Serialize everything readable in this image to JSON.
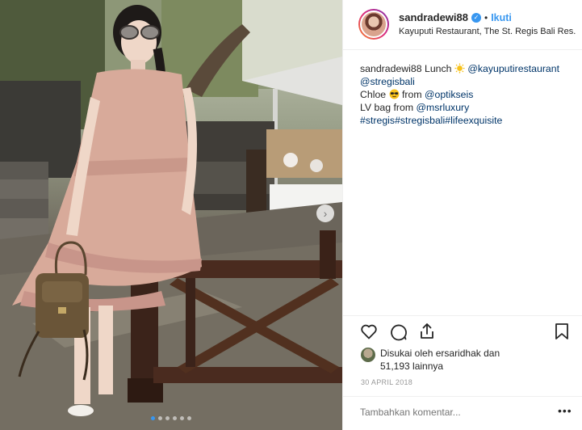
{
  "header": {
    "username": "sandradewi88",
    "separator": "•",
    "follow_label": "Ikuti",
    "location": "Kayuputi Restaurant, The St. Regis Bali Res..."
  },
  "caption": {
    "username": "sandradewi88",
    "line1_text": "Lunch",
    "mention_restaurant": "@kayuputirestaurant",
    "mention_stregis": "@stregisbali",
    "line3_text": "Chloe",
    "line3_from": "from",
    "mention_optik": "@optikseis",
    "line4_text": "LV bag from",
    "mention_msr": "@msrluxury",
    "hashtags": [
      "#stregis",
      "#stregisbali",
      "#lifeexquisite"
    ]
  },
  "likes": {
    "prefix": "Disukai oleh",
    "liker": "ersaridhak",
    "conjunction": "dan",
    "count": "51,193",
    "suffix": "lainnya"
  },
  "date": "30 APRIL 2018",
  "comment": {
    "placeholder": "Tambahkan komentar...",
    "more_label": "•••"
  },
  "carousel": {
    "slides": 6,
    "active_index": 0,
    "next_label": "›"
  },
  "colors": {
    "accent": "#3897f0",
    "link": "#003569",
    "muted": "#999999"
  },
  "icons": [
    "heart-icon",
    "comment-icon",
    "share-icon",
    "bookmark-icon",
    "sun-emoji-icon",
    "sunglasses-emoji-icon"
  ]
}
